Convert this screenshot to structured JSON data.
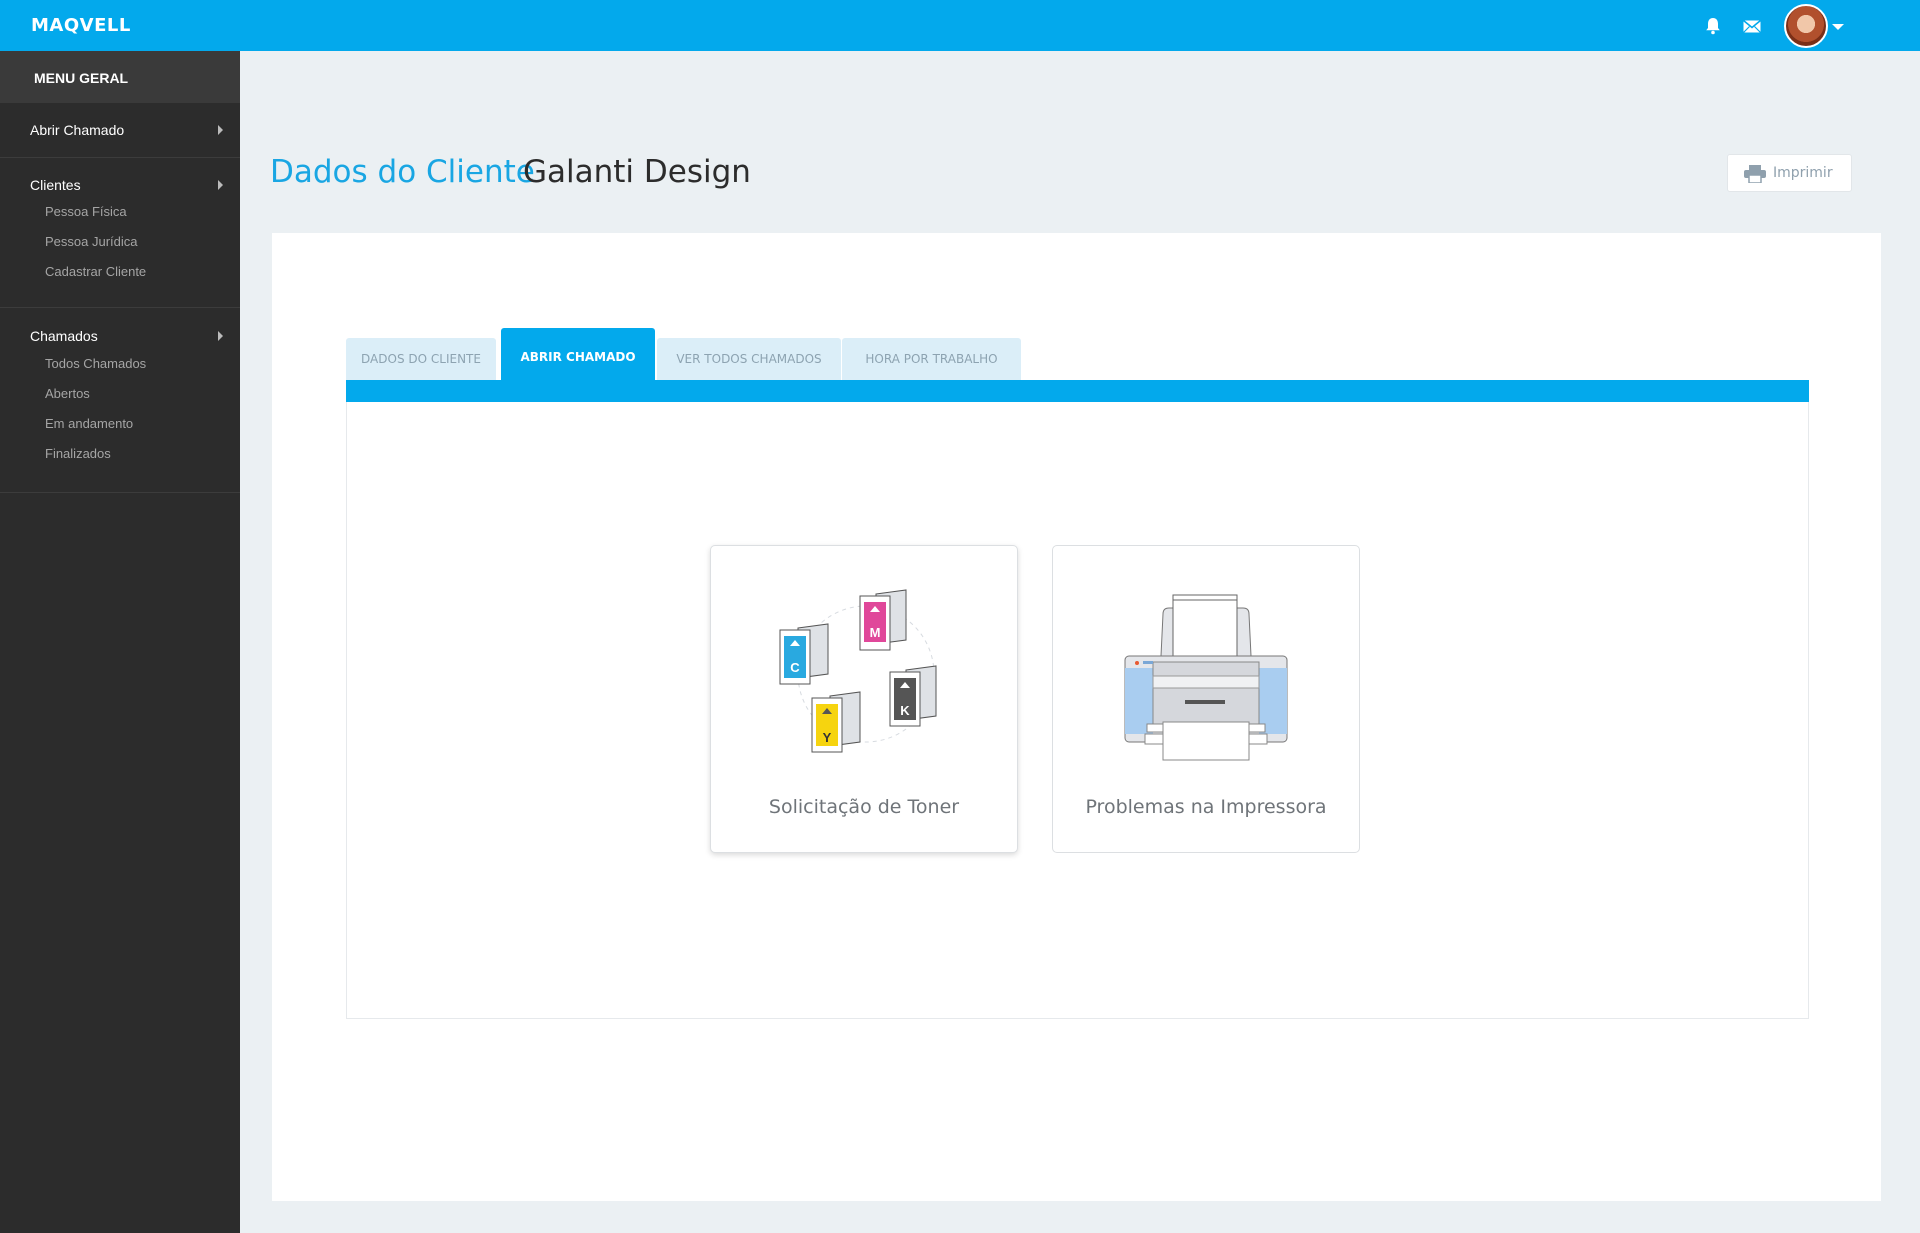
{
  "topbar": {
    "brand": "MAQVELL",
    "icons": [
      "bell-icon",
      "mail-icon",
      "user-avatar",
      "chevron-down-icon"
    ]
  },
  "sidebar": {
    "header": "MENU GERAL",
    "groups": [
      {
        "title": "Abrir Chamado",
        "items": []
      },
      {
        "title": "Clientes",
        "items": [
          "Pessoa Física",
          "Pessoa Jurídica",
          "Cadastrar Cliente"
        ]
      },
      {
        "title": "Chamados",
        "items": [
          "Todos Chamados",
          "Abertos",
          "Em andamento",
          "Finalizados"
        ]
      }
    ]
  },
  "page": {
    "title": "Dados do Cliente",
    "subtitle": "Galanti Design",
    "print_label": "Imprimir"
  },
  "tabs": [
    {
      "label": "DADOS DO CLIENTE",
      "active": false
    },
    {
      "label": "ABRIR CHAMADO",
      "active": true
    },
    {
      "label": "VER TODOS CHAMADOS",
      "active": false
    },
    {
      "label": "HORA POR TRABALHO",
      "active": false
    }
  ],
  "options": [
    {
      "label": "Solicitação de Toner",
      "icon": "toner-cartridges-icon",
      "letters": [
        "C",
        "M",
        "Y",
        "K"
      ]
    },
    {
      "label": "Problemas na Impressora",
      "icon": "printer-icon"
    }
  ],
  "colors": {
    "accent": "#03a9ec",
    "sidebar": "#2c2c2c",
    "background": "#ebf0f3",
    "cyan": "#29a9e0",
    "magenta": "#e0489a",
    "yellow": "#f6d40f",
    "black": "#555555"
  }
}
